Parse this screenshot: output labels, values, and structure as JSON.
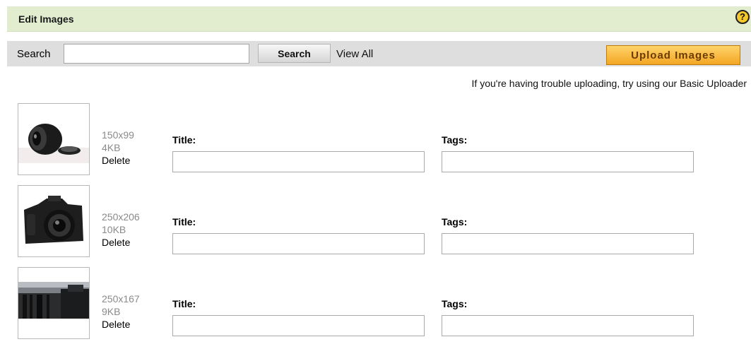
{
  "panel": {
    "title": "Edit Images",
    "help_label": "?"
  },
  "toolbar": {
    "search_label": "Search",
    "search_value": "",
    "search_button": "Search",
    "view_all": "View All",
    "upload_button": "Upload Images"
  },
  "notice": {
    "text": "If you're having trouble uploading, try using our ",
    "link": "Basic Uploader"
  },
  "labels": {
    "title": "Title:",
    "tags": "Tags:",
    "delete": "Delete"
  },
  "images": [
    {
      "dimensions": "150x99",
      "size": "4KB",
      "title": "",
      "tags": ""
    },
    {
      "dimensions": "250x206",
      "size": "10KB",
      "title": "",
      "tags": ""
    },
    {
      "dimensions": "250x167",
      "size": "9KB",
      "title": "",
      "tags": ""
    }
  ],
  "colors": {
    "header_bg": "#e2edd0",
    "toolbar_bg": "#dedede",
    "upload_button": "#f3a623",
    "help_icon": "#f4c72a"
  }
}
